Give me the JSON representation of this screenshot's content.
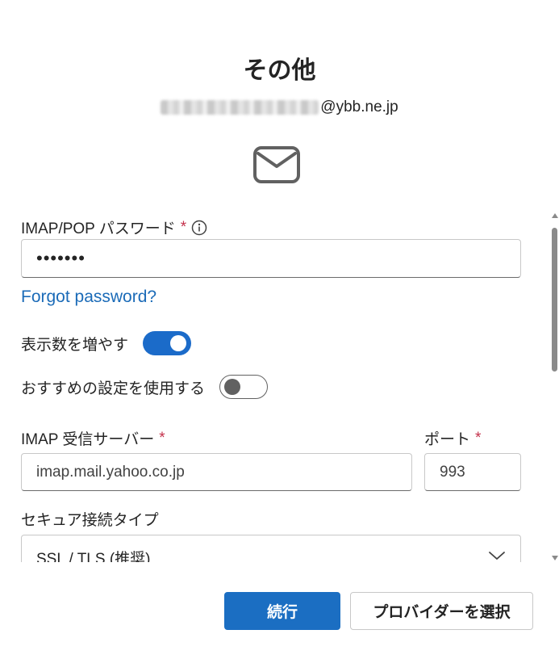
{
  "header": {
    "title": "その他",
    "email_domain": "@ybb.ne.jp"
  },
  "password": {
    "label": "IMAP/POP パスワード",
    "required_mark": "*",
    "value": "•••••••"
  },
  "forgot_password": "Forgot password?",
  "toggles": {
    "show_more": {
      "label": "表示数を増やす",
      "state": "on"
    },
    "recommended": {
      "label": "おすすめの設定を使用する",
      "state": "off"
    }
  },
  "imap_server": {
    "label": "IMAP 受信サーバー",
    "required_mark": "*",
    "value": "imap.mail.yahoo.co.jp"
  },
  "port": {
    "label": "ポート",
    "required_mark": "*",
    "value": "993"
  },
  "security": {
    "label": "セキュア接続タイプ",
    "selected": "SSL / TLS (推奨)"
  },
  "buttons": {
    "continue": "続行",
    "choose_provider": "プロバイダーを選択"
  },
  "colors": {
    "accent": "#1b6ec2",
    "link": "#1b6bb8",
    "required": "#c4314b"
  },
  "icons": {
    "mail": "mail-icon",
    "info": "info-icon",
    "chevron": "chevron-down-icon"
  }
}
